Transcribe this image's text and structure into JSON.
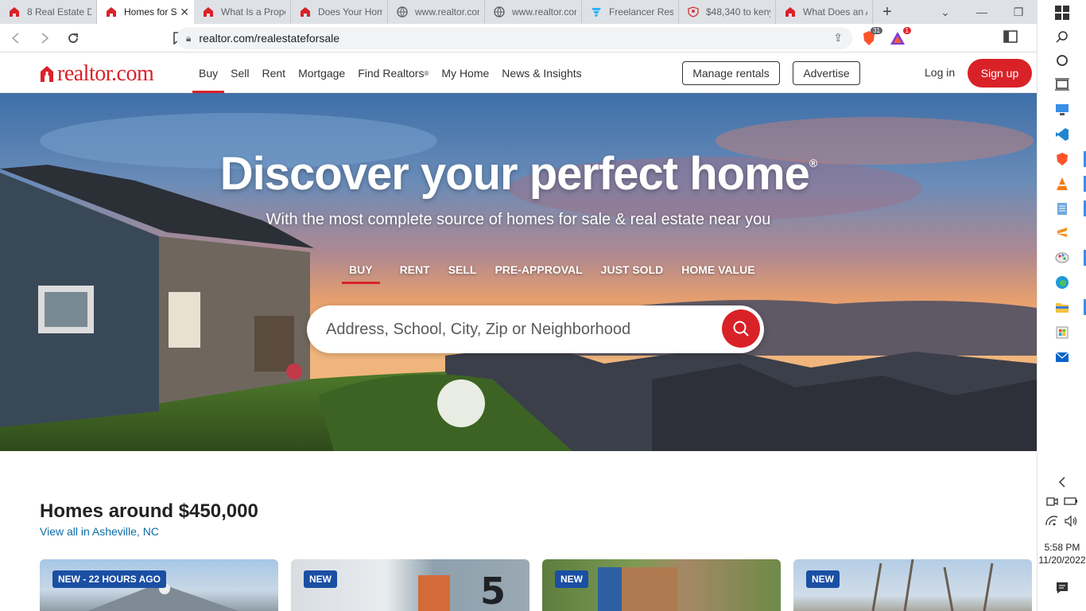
{
  "browser": {
    "tabs": [
      {
        "title": "8 Real Estate Do",
        "icon": "realtor-icon",
        "active": false
      },
      {
        "title": "Homes for S",
        "icon": "realtor-icon",
        "active": true
      },
      {
        "title": "What Is a Prope",
        "icon": "realtor-icon",
        "active": false
      },
      {
        "title": "Does Your Hom",
        "icon": "realtor-icon",
        "active": false
      },
      {
        "title": "www.realtor.con",
        "icon": "globe-icon",
        "active": false
      },
      {
        "title": "www.realtor.con",
        "icon": "globe-icon",
        "active": false
      },
      {
        "title": "Freelancer Resu",
        "icon": "freelancer-icon",
        "active": false
      },
      {
        "title": "$48,340 to keny",
        "icon": "shield-icon",
        "active": false
      },
      {
        "title": "What Does an A",
        "icon": "realtor-icon",
        "active": false
      }
    ],
    "url": "realtor.com/realestateforsale",
    "brave_shield_count": "31",
    "rewards_count": "1"
  },
  "header": {
    "logo_text": "realtor.com",
    "nav": [
      {
        "label": "Buy",
        "active": true
      },
      {
        "label": "Sell",
        "active": false
      },
      {
        "label": "Rent",
        "active": false
      },
      {
        "label": "Mortgage",
        "active": false
      },
      {
        "label": "Find Realtors",
        "sup": "®",
        "active": false
      },
      {
        "label": "My Home",
        "active": false
      },
      {
        "label": "News & Insights",
        "active": false
      }
    ],
    "manage_rentals": "Manage rentals",
    "advertise": "Advertise",
    "login": "Log in",
    "signup": "Sign up",
    "brand_color": "#d92228"
  },
  "hero": {
    "title": "Discover your perfect home",
    "title_mark": "®",
    "subtitle": "With the most complete source of homes for sale & real estate near you",
    "tabs": [
      {
        "label": "BUY",
        "active": true
      },
      {
        "label": "RENT",
        "active": false
      },
      {
        "label": "SELL",
        "active": false
      },
      {
        "label": "PRE-APPROVAL",
        "active": false
      },
      {
        "label": "JUST SOLD",
        "active": false
      },
      {
        "label": "HOME VALUE",
        "active": false
      }
    ],
    "search_placeholder": "Address, School, City, Zip or Neighborhood"
  },
  "homes": {
    "title": "Homes around $450,000",
    "link": "View all in Asheville, NC",
    "cards": [
      {
        "badge": "NEW - 22 HOURS AGO"
      },
      {
        "badge": "NEW"
      },
      {
        "badge": "NEW"
      },
      {
        "badge": "NEW"
      }
    ]
  },
  "taskbar": {
    "time": "5:58 PM",
    "date": "11/20/2022"
  }
}
